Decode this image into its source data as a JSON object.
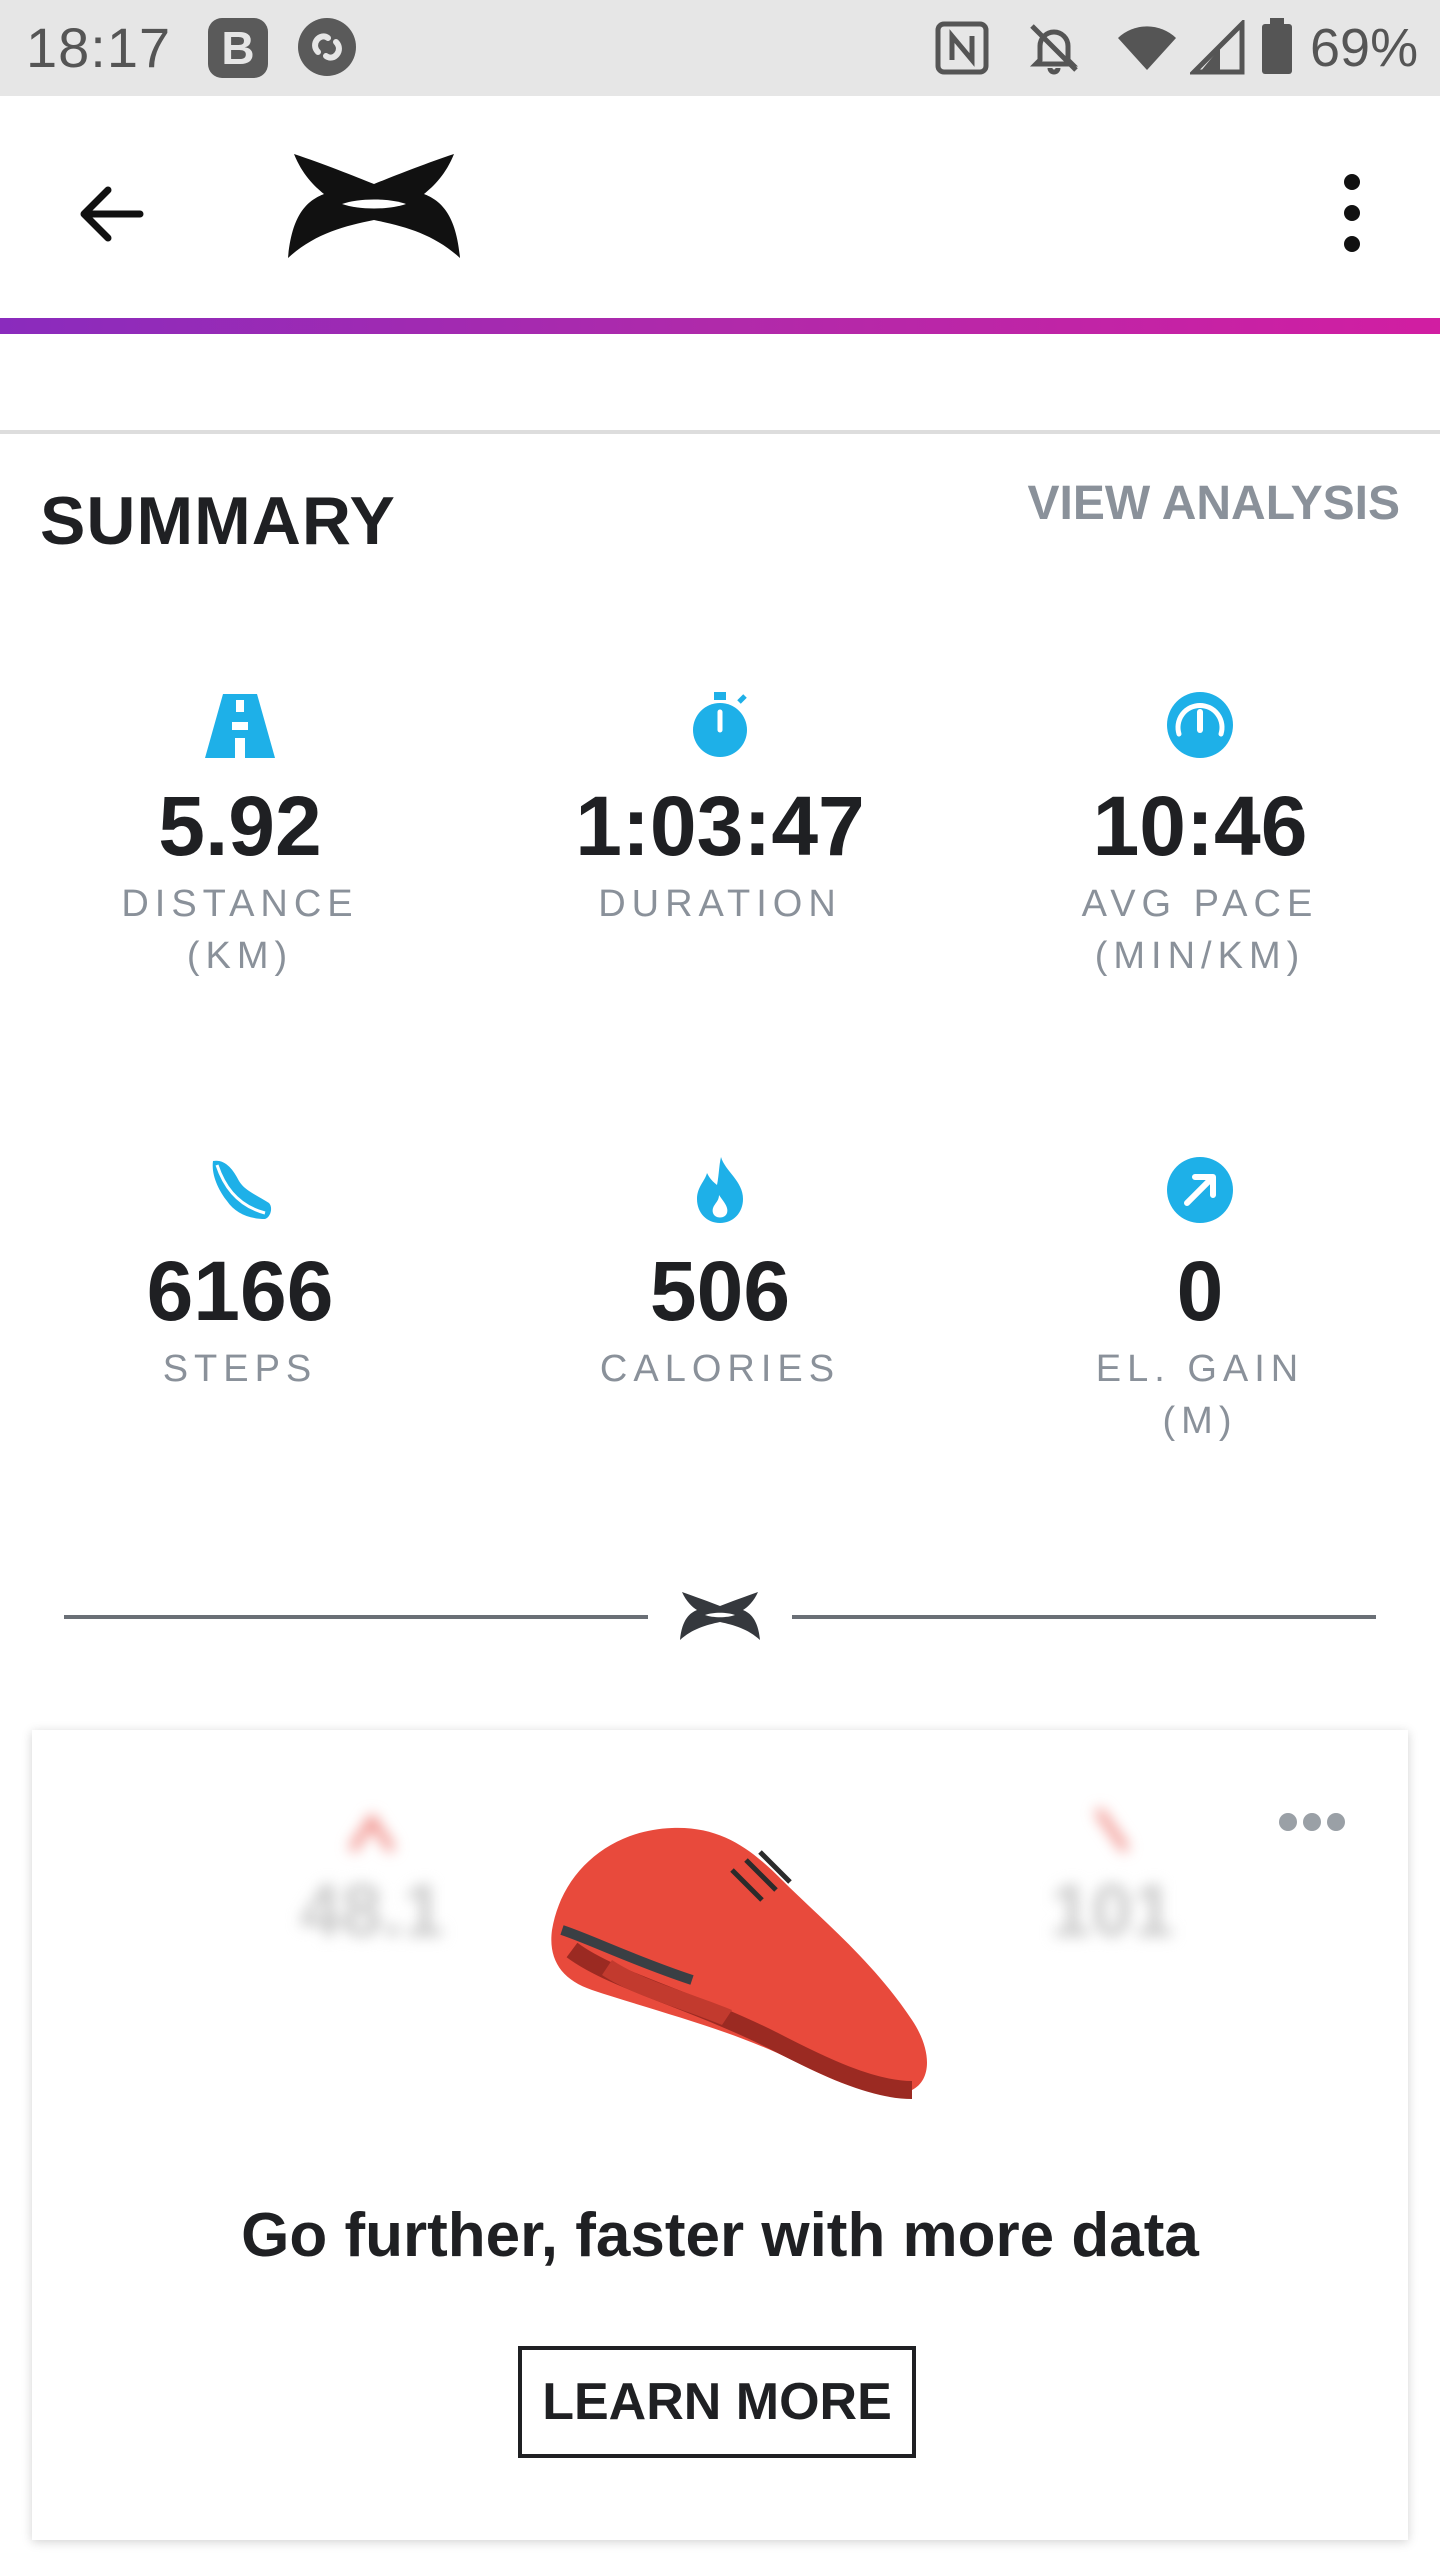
{
  "status_bar": {
    "time": "18:17",
    "b_label": "B",
    "battery_percent": "69%",
    "icons": [
      "b-app-icon",
      "shazam-icon",
      "nfc-icon",
      "mute-icon",
      "wifi-icon",
      "signal-icon",
      "battery-icon"
    ]
  },
  "appbar": {
    "icons": [
      "back-arrow-icon",
      "under-armour-logo",
      "more-vert-icon"
    ],
    "accent_gradient": [
      "#8a2bbd",
      "#d11ea2"
    ]
  },
  "summary": {
    "title": "SUMMARY",
    "view_analysis": "VIEW ANALYSIS",
    "accent_color": "#1eb0e8",
    "stats": [
      {
        "icon": "road-icon",
        "value": "5.92",
        "label": "DISTANCE\n(KM)"
      },
      {
        "icon": "stopwatch-icon",
        "value": "1:03:47",
        "label": "DURATION"
      },
      {
        "icon": "speedometer-icon",
        "value": "10:46",
        "label": "AVG PACE\n(MIN/KM)"
      },
      {
        "icon": "shoe-icon",
        "value": "6166",
        "label": "STEPS"
      },
      {
        "icon": "flame-icon",
        "value": "506",
        "label": "CALORIES"
      },
      {
        "icon": "arrow-up-right-icon",
        "value": "0",
        "label": "EL. GAIN\n(M)"
      }
    ]
  },
  "promo": {
    "blurred_left_value": "48.1",
    "blurred_right_value": "101",
    "headline": "Go further, faster with more data",
    "button_label": "LEARN MORE",
    "icons": [
      "more-horiz-icon",
      "running-shoe-image"
    ]
  }
}
